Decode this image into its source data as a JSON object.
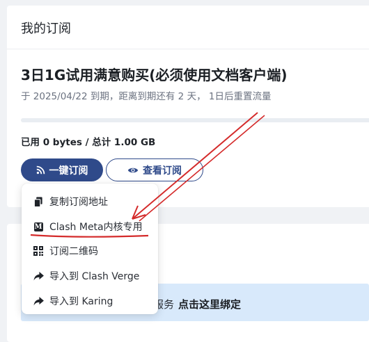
{
  "subscription": {
    "header_title": "我的订阅",
    "plan_name": "3日1G试用满意购买(必须使用文档客户端)",
    "expiry_text": "于 2025/04/22 到期，距离到期还有 2 天， 1日后重置流量",
    "usage_text": "已用 0 bytes / 总计 1.00 GB",
    "usage_fraction": 0.0,
    "one_click_label": "一键订阅",
    "view_label": "查看订阅"
  },
  "banner": {
    "text_visible": "务服务",
    "link_text": "点击这里绑定"
  },
  "dropdown": {
    "items": [
      {
        "label": "复制订阅地址",
        "icon": "copy-icon"
      },
      {
        "label": "Clash Meta内核专用",
        "icon": "m-logo-icon"
      },
      {
        "label": "订阅二维码",
        "icon": "qrcode-icon"
      },
      {
        "label": "导入到 Clash Verge",
        "icon": "share-icon"
      },
      {
        "label": "导入到 Karing",
        "icon": "share-icon"
      }
    ]
  },
  "colors": {
    "primary": "#2f4a8a",
    "annotation": "#d42a2a",
    "banner_bg": "#d8e9fb"
  }
}
